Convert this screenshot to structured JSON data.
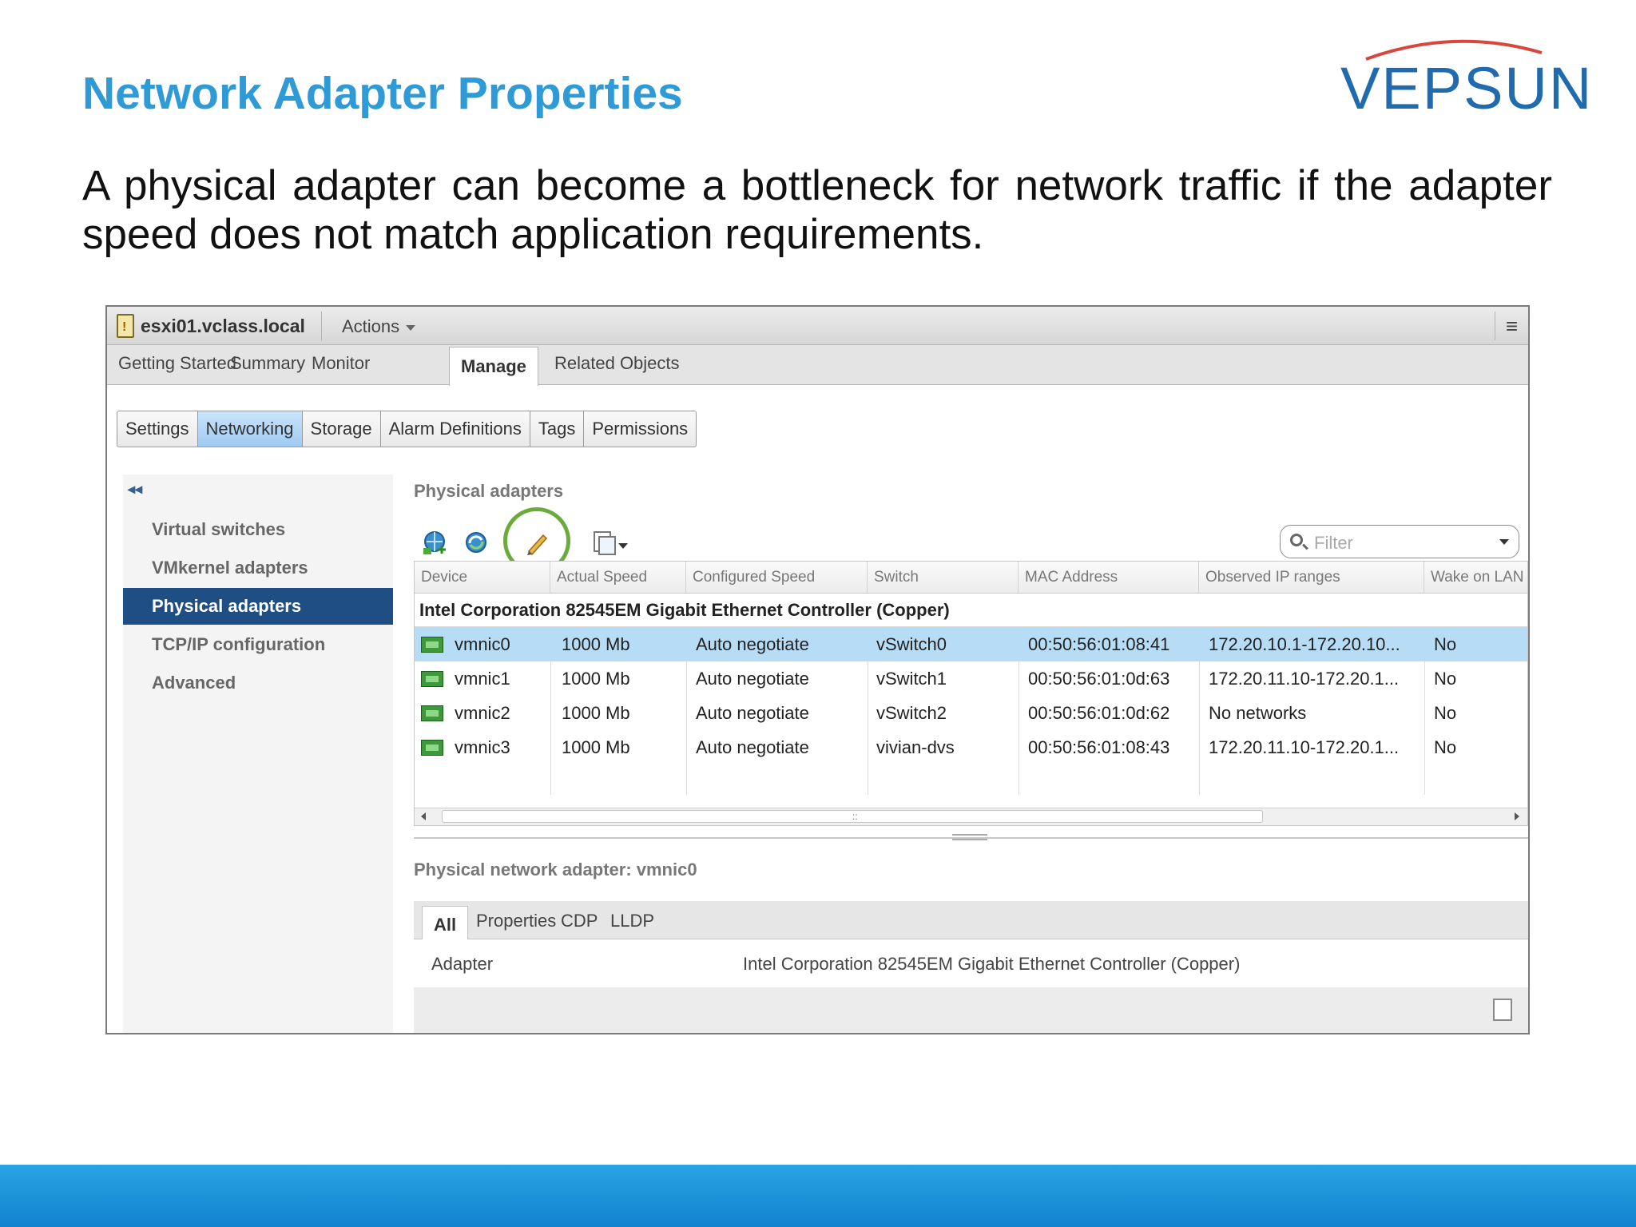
{
  "slide": {
    "title": "Network Adapter Properties",
    "logo_text": "VEPSUN",
    "body": "A physical adapter can become a bottleneck for network traffic if the adapter speed does not match application requirements."
  },
  "header": {
    "host": "esxi01.vclass.local",
    "actions": "Actions",
    "menu_glyph": "≡"
  },
  "tabs": [
    "Getting Started",
    "Summary",
    "Monitor",
    "Manage",
    "Related Objects"
  ],
  "active_tab": "Manage",
  "subtabs": [
    "Settings",
    "Networking",
    "Storage",
    "Alarm Definitions",
    "Tags",
    "Permissions"
  ],
  "active_subtab": "Networking",
  "leftnav": {
    "collapse_glyph": "◂◂",
    "items": [
      "Virtual switches",
      "VMkernel adapters",
      "Physical adapters",
      "TCP/IP configuration",
      "Advanced"
    ],
    "active": "Physical adapters"
  },
  "panel": {
    "title": "Physical adapters",
    "toolbar_icons": [
      "add-networking-icon",
      "refresh-icon",
      "edit-icon",
      "actions-menu-icon"
    ],
    "filter_placeholder": "Filter"
  },
  "table": {
    "columns": [
      "Device",
      "Actual Speed",
      "Configured Speed",
      "Switch",
      "MAC Address",
      "Observed IP ranges",
      "Wake on LAN"
    ],
    "group": "Intel Corporation 82545EM Gigabit Ethernet Controller (Copper)",
    "rows": [
      {
        "device": "vmnic0",
        "actual_speed": "1000 Mb",
        "configured_speed": "Auto negotiate",
        "switch": "vSwitch0",
        "mac": "00:50:56:01:08:41",
        "ip_ranges": "172.20.10.1-172.20.10...",
        "wol": "No",
        "selected": true
      },
      {
        "device": "vmnic1",
        "actual_speed": "1000 Mb",
        "configured_speed": "Auto negotiate",
        "switch": "vSwitch1",
        "mac": "00:50:56:01:0d:63",
        "ip_ranges": "172.20.11.10-172.20.1...",
        "wol": "No",
        "selected": false
      },
      {
        "device": "vmnic2",
        "actual_speed": "1000 Mb",
        "configured_speed": "Auto negotiate",
        "switch": "vSwitch2",
        "mac": "00:50:56:01:0d:62",
        "ip_ranges": "No networks",
        "wol": "No",
        "selected": false
      },
      {
        "device": "vmnic3",
        "actual_speed": "1000 Mb",
        "configured_speed": "Auto negotiate",
        "switch": "vivian-dvs",
        "mac": "00:50:56:01:08:43",
        "ip_ranges": "172.20.11.10-172.20.1...",
        "wol": "No",
        "selected": false
      }
    ]
  },
  "detail": {
    "title": "Physical network adapter: vmnic0",
    "tabs": [
      "All",
      "Properties",
      "CDP",
      "LLDP"
    ],
    "active_tab": "All",
    "property_label": "Adapter",
    "property_value": "Intel Corporation 82545EM Gigabit Ethernet Controller (Copper)"
  },
  "colors": {
    "title": "#2e9ad6",
    "nav_active": "#1e4e84",
    "row_selected": "#b7dcf5",
    "highlight_circle": "#6aab3c",
    "bottom_bar": "#1e93da"
  }
}
